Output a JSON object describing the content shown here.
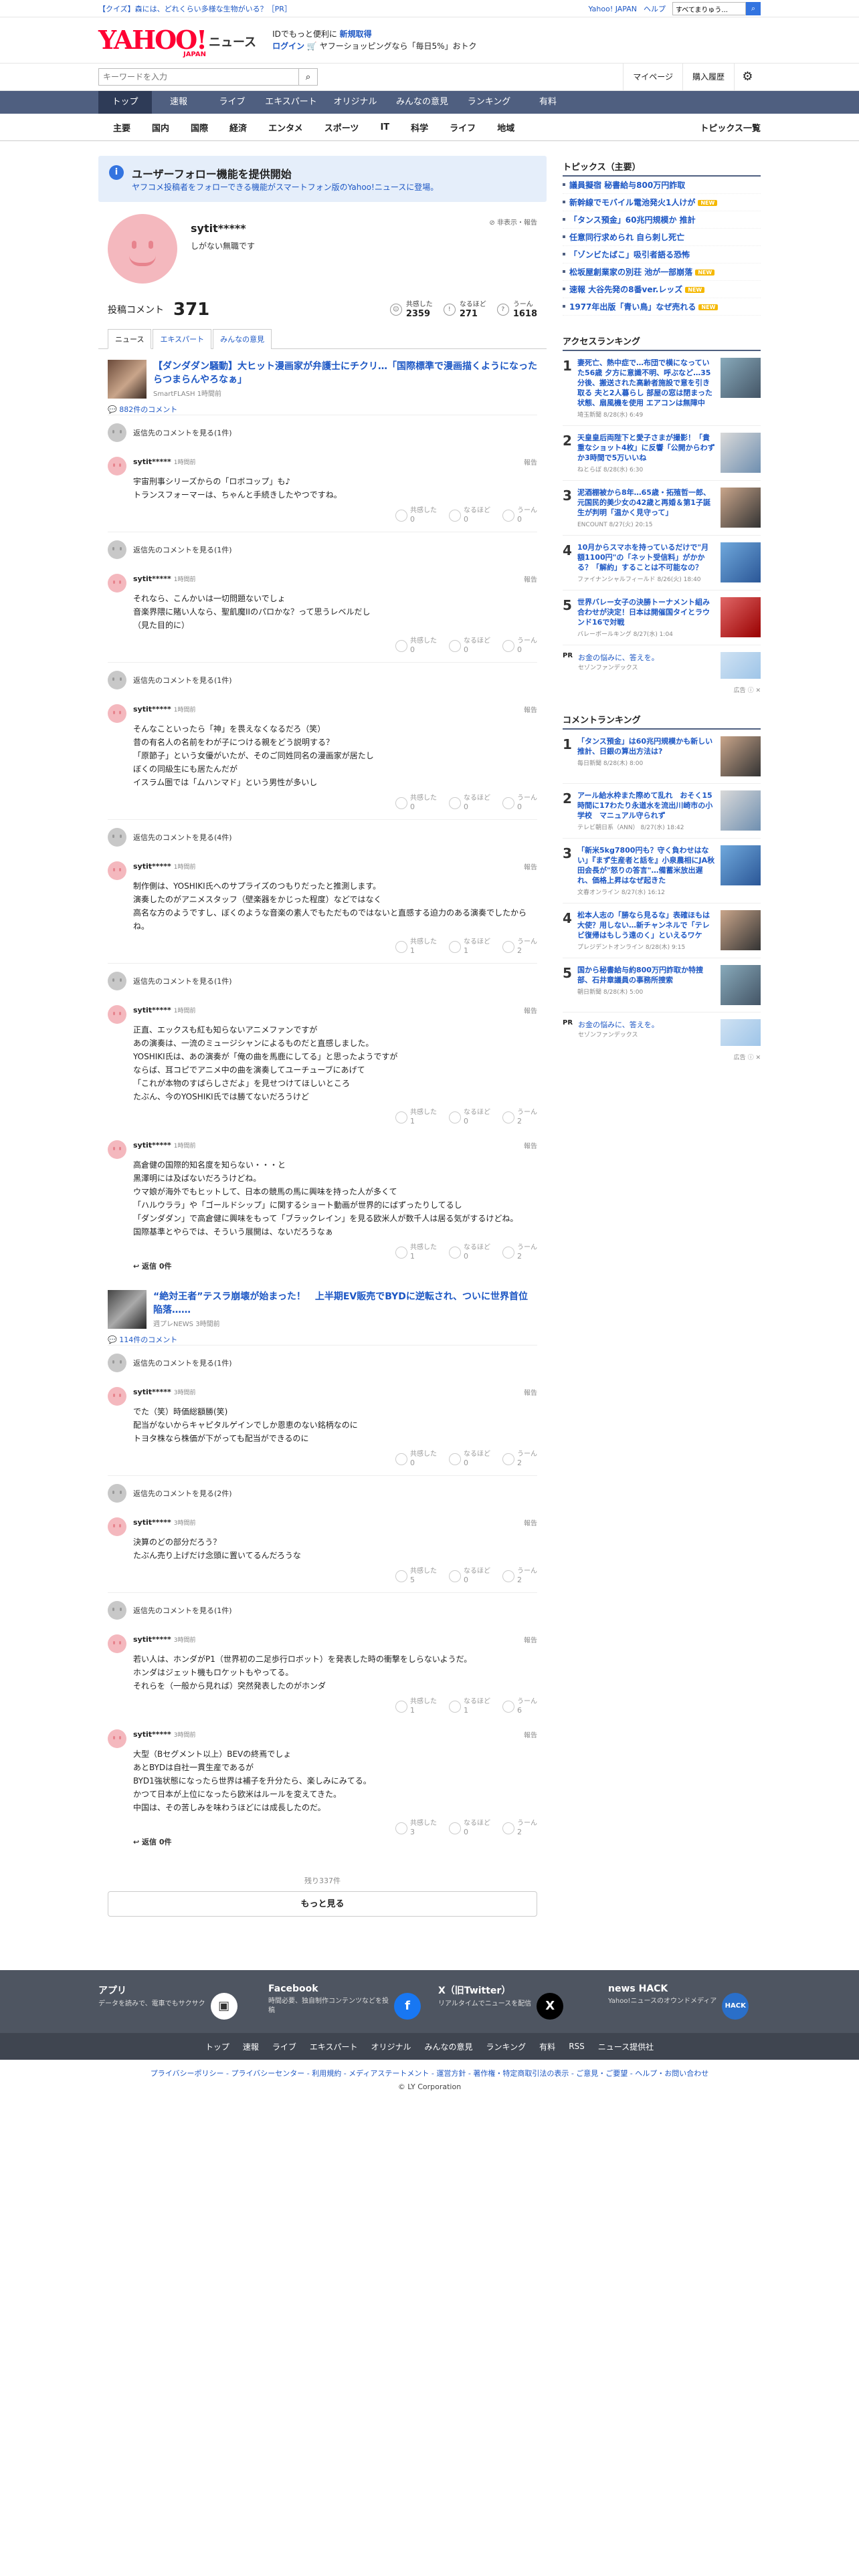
{
  "promo": {
    "text": "【クイズ】森には、どれくらい多様な生物がいる？［PR］",
    "links": [
      "Yahoo! JAPAN",
      "ヘルプ"
    ],
    "search_placeholder": "ウェブ検索",
    "search_value": "すべてまりゅう..."
  },
  "header": {
    "logo_main": "YAHOO!",
    "logo_sub": "JAPAN",
    "logo_news": "ニュース",
    "promo_line1_a": "IDでもっと便利に",
    "promo_line1_b": "新規取得",
    "promo_line2_login": "ログイン",
    "promo_line2_rest": "ヤフーショッピングなら「毎日5%」おトク"
  },
  "search": {
    "placeholder": "キーワードを入力",
    "mypage": "マイページ",
    "history": "購入履歴"
  },
  "nav": [
    "トップ",
    "速報",
    "ライブ",
    "エキスパート",
    "オリジナル",
    "みんなの意見",
    "ランキング",
    "有料"
  ],
  "subnav": [
    "主要",
    "国内",
    "国際",
    "経済",
    "エンタメ",
    "スポーツ",
    "IT",
    "科学",
    "ライフ",
    "地域"
  ],
  "subnav_right": "トピックス一覧",
  "notice": {
    "title": "ユーザーフォロー機能を提供開始",
    "body": "ヤフコメ投稿者をフォローできる機能がスマートフォン版のYahoo!ニュースに登場。"
  },
  "profile": {
    "name": "sytit*****",
    "bio": "しがない無職です",
    "report": "非表示・報告",
    "comment_label": "投稿コメント",
    "comment_count": "371",
    "reactions": [
      {
        "icon": "☺",
        "label": "共感した",
        "value": "2359"
      },
      {
        "icon": "!",
        "label": "なるほど",
        "value": "271"
      },
      {
        "icon": "?",
        "label": "うーん",
        "value": "1618"
      }
    ]
  },
  "tabs": [
    "ニュース",
    "エキスパート",
    "みんなの意見"
  ],
  "reaction_labels": [
    "共感した",
    "なるほど",
    "うーん"
  ],
  "report_label": "報告",
  "articles": [
    {
      "title": "【ダンダダン騒動】大ヒット漫画家が弁護士にチクリ…「国際標準で漫画描くようになったらつまらんやろなぁ」",
      "source": "SmartFLASH 1時間前",
      "comment_count": "882件のコメント",
      "threads": [
        {
          "parent": "返信先のコメントを見る(1件)",
          "replies": [
            {
              "user": "sytit*****",
              "time": "1時間前",
              "text": "宇宙刑事シリーズからの「ロボコップ」も♪\nトランスフォーマーは、ちゃんと手続きしたやつですね。",
              "r": [
                "0",
                "0",
                "0"
              ]
            }
          ]
        },
        {
          "parent": "返信先のコメントを見る(1件)",
          "replies": [
            {
              "user": "sytit*****",
              "time": "1時間前",
              "text": "それなら、こんかいは一切問題ないでしょ\n音楽界隈に賭い人なら、聖飢魔IIのパロかな？って思うレベルだし\n（見た目的に）",
              "r": [
                "0",
                "0",
                "0"
              ]
            }
          ]
        },
        {
          "parent": "返信先のコメントを見る(1件)",
          "replies": [
            {
              "user": "sytit*****",
              "time": "1時間前",
              "text": "そんなこといったら「神」を畏えなくなるだろ（笑）\n昔の有名人の名前をわが子につける親をどう説明する？\n「原節子」という女優がいたが、そのご同姓同名の漫画家が居たし\nぼくの同級生にも居たんだが\nイスラム圏では「ムハンマド」という男性が多いし",
              "r": [
                "0",
                "0",
                "0"
              ]
            }
          ]
        },
        {
          "parent": "返信先のコメントを見る(4件)",
          "replies": [
            {
              "user": "sytit*****",
              "time": "1時間前",
              "text": "制作側は、YOSHIKI氏へのサプライズのつもりだったと推測します。\n演奏したのがアニメスタッフ（壁楽器をかじった程度）などではなく\n高名な方のようですし、ぼくのような音楽の素人でもただものではないと直感する迫力のある演奏でしたからね。",
              "r": [
                "1",
                "1",
                "2"
              ]
            }
          ]
        },
        {
          "parent": "返信先のコメントを見る(1件)",
          "replies": [
            {
              "user": "sytit*****",
              "time": "1時間前",
              "text": "正直、エックスも紅も知らないアニメファンですが\nあの演奏は、一流のミュージシャンによるものだと直感しました。\nYOSHIKI氏は、あの演奏が「俺の曲を馬鹿にしてる」と思ったようですが\nならば、耳コピでアニメ中の曲を演奏してユーチューブにあげて\n「これが本物のすばらしさだよ」を見せつけてほしいところ\nたぶん、今のYOSHIKI氏では勝てないだろうけど",
              "r": [
                "1",
                "0",
                "2"
              ]
            },
            {
              "user": "sytit*****",
              "time": "1時間前",
              "text": "高倉健の国際的知名度を知らない・・・と\n黒澤明には及ばないだろうけどね。\nウマ娘が海外でもヒットして、日本の競馬の馬に興味を持った人が多くて\n「ハルウララ」や「ゴールドシップ」に関するショート動画が世界的にばずったりしてるし\n「ダンダダン」で高倉健に興味をもって「ブラックレイン」を見る欧米人が数千人は居る気がするけどね。\n国際基準とやらでは、そういう展開は、ないだろうなぁ",
              "r": [
                "1",
                "0",
                "2"
              ],
              "reply_btn": "返信 0件"
            }
          ]
        }
      ]
    },
    {
      "title": "“絶対王者”テスラ崩壊が始まった！　上半期EV販売でBYDに逆転され、ついに世界首位陥落……",
      "source": "週プレNEWS 3時間前",
      "comment_count": "114件のコメント",
      "threads": [
        {
          "parent": "返信先のコメントを見る(1件)",
          "replies": [
            {
              "user": "sytit*****",
              "time": "3時間前",
              "text": "でた（笑）時価総額勝(笑)\n配当がないからキャピタルゲインでしか恩恵のない銘柄なのに\nトヨタ株なら株価が下がっても配当ができるのに",
              "r": [
                "0",
                "0",
                "2"
              ]
            }
          ]
        },
        {
          "parent": "返信先のコメントを見る(2件)",
          "replies": [
            {
              "user": "sytit*****",
              "time": "3時間前",
              "text": "決算のどの部分だろう？\nたぶん売り上げだけ念頭に置いてるんだろうな",
              "r": [
                "5",
                "0",
                "2"
              ]
            }
          ]
        },
        {
          "parent": "返信先のコメントを見る(1件)",
          "replies": [
            {
              "user": "sytit*****",
              "time": "3時間前",
              "text": "若い人は、ホンダがP1（世界初の二足歩行ロボット）を発表した時の衝撃をしらないようだ。\nホンダはジェット機もロケットもやってる。\nそれらを（一般から見れば）突然発表したのがホンダ",
              "r": [
                "1",
                "1",
                "6"
              ]
            },
            {
              "user": "sytit*****",
              "time": "3時間前",
              "text": "大型（Bセグメント以上）BEVの終焉でしょ\nあとBYDは自社一貫生産であるが\nBYD1強状態になったら世界は補子を升分たら、楽しみにみてる。\nかつて日本が上位になったら欧米はルールを変えてきた。\n中国は、その苦しみを味わうほどには成長したのだ。",
              "r": [
                "3",
                "0",
                "2"
              ],
              "reply_btn": "返信 0件"
            }
          ]
        }
      ]
    }
  ],
  "remaining": "残り337件",
  "more_button": "もっと見る",
  "sidebar": {
    "topics_title": "トピックス（主要）",
    "topics": [
      {
        "text": "議員擬宿 秘書給与800万円詐取",
        "badge": ""
      },
      {
        "text": "新幹線でモバイル電池発火1人けが",
        "badge": "NEW"
      },
      {
        "text": "「タンス預金」60兆円規模か 推計",
        "badge": ""
      },
      {
        "text": "任意同行求められ 自ら刺し死亡",
        "badge": ""
      },
      {
        "text": "「ゾンビたばこ」吸引者語る恐怖",
        "badge": ""
      },
      {
        "text": "松坂屋創業家の別荘 池が一部崩落",
        "badge": "NEW"
      },
      {
        "text": "速報 大谷先発の8番ver.レッズ",
        "badge": "NEW"
      },
      {
        "text": "1977年出版「青い鳥」なぜ売れる",
        "badge": "NEW"
      }
    ],
    "access_title": "アクセスランキング",
    "access": [
      {
        "no": "1",
        "title": "妻死亡、熱中症で…布団で横になっていた56歳 夕方に意識不明、呼ぶなど…35分後、搬送された高齢者施設で意を引き取る 夫と2人暮らし 部屋の窓は閉まった状態、扇風機を使用 エアコンは無障中",
        "src": "埼玉新聞 8/28(水) 6:49"
      },
      {
        "no": "2",
        "title": "天皇皇后両陛下と愛子さまが撮影！「貴重なショット4枚」に反響「公開からわずか3時間で5万いいね",
        "src": "ねとらぼ 8/28(水) 6:30"
      },
      {
        "no": "3",
        "title": "泥酒棚被から8年…65歳・拓殖哲一郎、元国民的美少女の42歳と再婚＆第1子誕生が判明「温かく見守って」",
        "src": "ENCOUNT 8/27(火) 20:15"
      },
      {
        "no": "4",
        "title": "10月からスマホを持っているだけで\"月額1100円\"の「ネット受信料」がかかる？「解約」することは不可能なの？",
        "src": "ファイナンシャルフィールド 8/26(火) 18:40"
      },
      {
        "no": "5",
        "title": "世界バレー女子の決勝トーナメント組み合わせが決定！日本は開催国タイとラウンド16で対戦",
        "src": "バレーボールキング 8/27(水) 1:04"
      }
    ],
    "pr1": {
      "tag": "PR",
      "title": "お金の悩みに、答えを。",
      "src": "セゾンファンデックス"
    },
    "ad_label": "広告",
    "comment_rank_title": "コメントランキング",
    "comment_rank": [
      {
        "no": "1",
        "title": "「タンス預金」は60兆円規模かも新しい推計、日銀の算出方法は?",
        "src": "毎日新聞 8/28(木) 8:00"
      },
      {
        "no": "2",
        "title": "アール給水枠また際めて乱れ　おそく15時間に17わたり永道水を流出川崎市の小学校　マニュアル守られず",
        "src": "テレビ朝日系（ANN） 8/27(水) 18:42"
      },
      {
        "no": "3",
        "title": "「新米5kg7800円も？守く負わせはない」『まず生産者と話を』小泉農相にJA秋田会長が\"怒りの答言\"…備蓄米放出遅れ、価格上昇はなぜ起きた",
        "src": "文春オンライン 8/27(水) 16:12"
      },
      {
        "no": "4",
        "title": "松本人志の「勝なら見るな」表確ほもは大使？用しない…新チャンネルで「テレビ復帰はもしう遠のく」といえるワケ",
        "src": "プレジデントオンライン 8/28(木) 9:15"
      },
      {
        "no": "5",
        "title": "国から秘書給与約800万円詐取か特捜部、石井章議員の事務所捜索",
        "src": "朝日新聞 8/28(木) 5:00"
      }
    ],
    "pr2": {
      "tag": "PR",
      "title": "お金の悩みに、答えを。",
      "src": "セゾンファンデックス"
    }
  },
  "footer": {
    "boxes": [
      {
        "title": "アプリ",
        "desc": "データを読みで、電車でもサクサク",
        "icon": "▣"
      },
      {
        "title": "Facebook",
        "desc": "時間必要、独自制作コンテンツなどを投稿",
        "icon": "f"
      },
      {
        "title": "X（旧Twitter）",
        "desc": "リアルタイムでニュースを配信",
        "icon": "X"
      },
      {
        "title": "news HACK",
        "desc": "Yahoo!ニュースのオウンドメディア",
        "icon": "HACK"
      }
    ],
    "nav": [
      "トップ",
      "速報",
      "ライブ",
      "エキスパート",
      "オリジナル",
      "みんなの意見",
      "ランキング",
      "有料",
      "RSS",
      "ニュース提供社"
    ],
    "links": "プライバシーポリシー - プライバシーセンター - 利用規約 - メディアステートメント - 運営方針 - 著作権・特定商取引法の表示 - ご意見・ご要望 - ヘルプ・お問い合わせ",
    "copyright": "© LY Corporation"
  }
}
